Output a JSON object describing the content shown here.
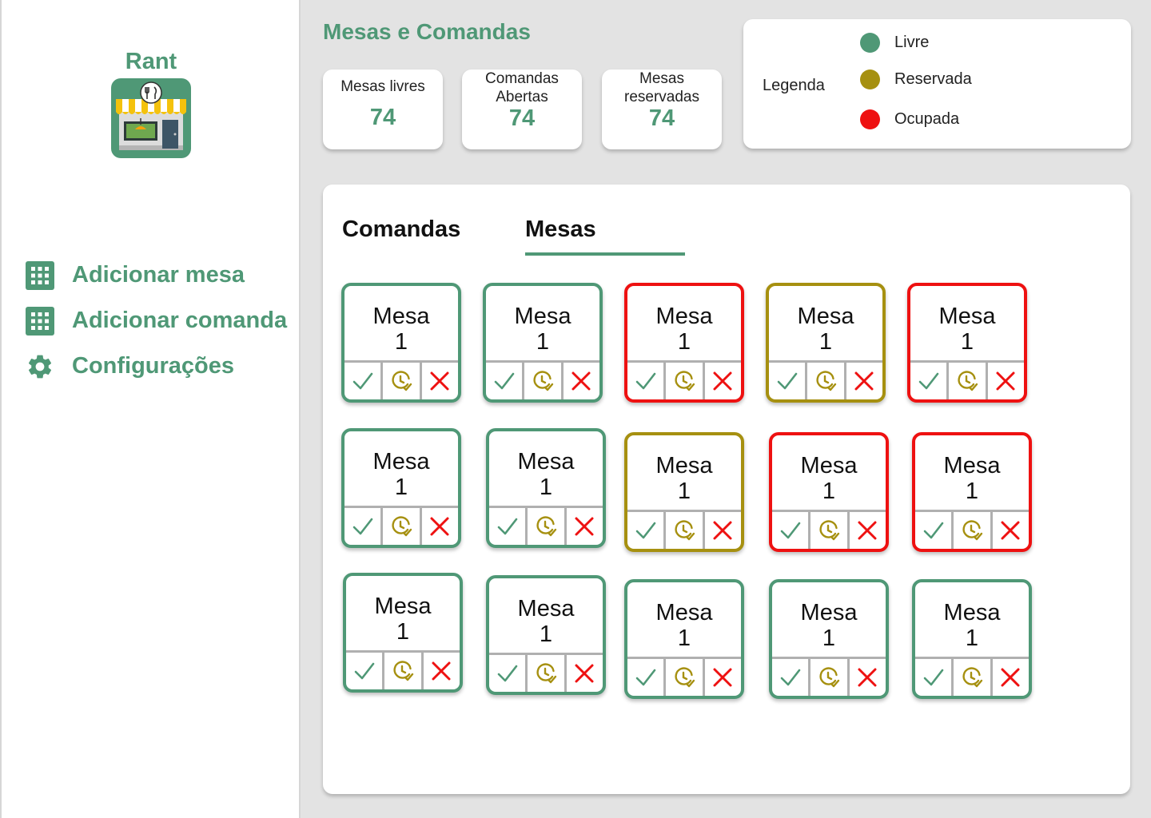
{
  "sidebar": {
    "brand": "Rant",
    "items": [
      {
        "label": "Adicionar mesa",
        "icon": "grid-icon"
      },
      {
        "label": "Adicionar comanda",
        "icon": "grid-icon"
      },
      {
        "label": "Configurações",
        "icon": "gear-icon"
      }
    ]
  },
  "header": {
    "title": "Mesas e Comandas",
    "stats": [
      {
        "label_line1": "Mesas livres",
        "label_line2": "",
        "value": "74"
      },
      {
        "label_line1": "Comandas",
        "label_line2": "Abertas",
        "value": "74"
      },
      {
        "label_line1": "Mesas",
        "label_line2": "reservadas",
        "value": "74"
      }
    ]
  },
  "legend": {
    "title": "Legenda",
    "items": [
      {
        "label": "Livre",
        "color": "#4f9876"
      },
      {
        "label": "Reservada",
        "color": "#a69010"
      },
      {
        "label": "Ocupada",
        "color": "#ee1111"
      }
    ]
  },
  "tabs": [
    {
      "label": "Comandas",
      "active": false
    },
    {
      "label": "Mesas",
      "active": true
    }
  ],
  "colors": {
    "livre": "#4f9876",
    "reservada": "#a69010",
    "ocupada": "#ee1111"
  },
  "mesas": [
    {
      "line1": "Mesa",
      "line2": "1",
      "status": "livre"
    },
    {
      "line1": "Mesa",
      "line2": "1",
      "status": "livre"
    },
    {
      "line1": "Mesa",
      "line2": "1",
      "status": "ocupada"
    },
    {
      "line1": "Mesa",
      "line2": "1",
      "status": "reservada"
    },
    {
      "line1": "Mesa",
      "line2": "1",
      "status": "ocupada"
    },
    {
      "line1": "Mesa",
      "line2": "1",
      "status": "livre"
    },
    {
      "line1": "Mesa",
      "line2": "1",
      "status": "livre"
    },
    {
      "line1": "Mesa",
      "line2": "1",
      "status": "reservada"
    },
    {
      "line1": "Mesa",
      "line2": "1",
      "status": "ocupada"
    },
    {
      "line1": "Mesa",
      "line2": "1",
      "status": "ocupada"
    },
    {
      "line1": "Mesa",
      "line2": "1",
      "status": "livre"
    },
    {
      "line1": "Mesa",
      "line2": "1",
      "status": "livre"
    },
    {
      "line1": "Mesa",
      "line2": "1",
      "status": "livre"
    },
    {
      "line1": "Mesa",
      "line2": "1",
      "status": "livre"
    },
    {
      "line1": "Mesa",
      "line2": "1",
      "status": "livre"
    }
  ],
  "mesa_actions": [
    "check-icon",
    "clock-icon",
    "close-icon"
  ]
}
